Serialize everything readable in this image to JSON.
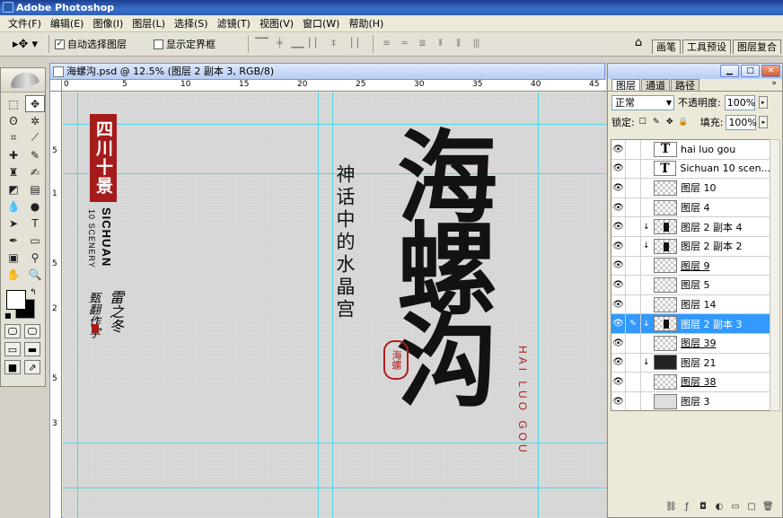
{
  "app": {
    "title": "Adobe Photoshop"
  },
  "menu": [
    "文件(F)",
    "编辑(E)",
    "图像(I)",
    "图层(L)",
    "选择(S)",
    "滤镜(T)",
    "视图(V)",
    "窗口(W)",
    "帮助(H)"
  ],
  "options": {
    "auto_select_label": "自动选择图层",
    "auto_select_checked": "✓",
    "show_bounds_label": "显示定界框",
    "align_icons": [
      "▔▔",
      "╪",
      "▁▁",
      "▏▏",
      "‡",
      "▕▕"
    ],
    "distribute_icons": [
      "≡",
      "═",
      "≣",
      "⦀",
      "⫼",
      "|||"
    ]
  },
  "palette_well": {
    "tabs": [
      "画笔",
      "工具预设",
      "图层复合"
    ]
  },
  "document": {
    "title": "海螺沟.psd @ 12.5% (图层 2 副本 3, RGB/8)",
    "ruler_h": [
      "0",
      "5",
      "10",
      "15",
      "20",
      "25",
      "30",
      "35",
      "40",
      "45"
    ],
    "ruler_v": [
      "5",
      "1",
      "5",
      "2",
      "5",
      "3"
    ]
  },
  "artwork": {
    "red_seal": "四川十景",
    "sichuan": "SICHUAN",
    "scenery": "10 SCENERY",
    "signature_1": "雷之冬",
    "signature_2": "甄翻作字",
    "poem": "神话中的水晶宫",
    "calligraphy": "海螺沟",
    "round_seal": "海螺",
    "hailuo": "HAI LUO GOU"
  },
  "layers_panel": {
    "tabs": [
      "图层",
      "通道",
      "路径"
    ],
    "active_tab": 0,
    "blend_mode": "正常",
    "opacity_label": "不透明度:",
    "opacity_value": "100%",
    "lock_label": "锁定:",
    "lock_icons": [
      "☐",
      "✎",
      "✥",
      "🔒"
    ],
    "fill_label": "填充:",
    "fill_value": "100%",
    "layers": [
      {
        "name": "hai luo gou",
        "thumb": "T",
        "underline": false,
        "clip": "",
        "selected": false,
        "brush": ""
      },
      {
        "name": "Sichuan  10 scen...",
        "thumb": "T",
        "underline": false,
        "clip": "",
        "selected": false,
        "brush": ""
      },
      {
        "name": "图层 10",
        "thumb": "checker",
        "underline": false,
        "clip": "",
        "selected": false,
        "brush": ""
      },
      {
        "name": "图层 4",
        "thumb": "checker",
        "underline": false,
        "clip": "",
        "selected": false,
        "brush": ""
      },
      {
        "name": "图层 2 副本 4",
        "thumb": "blot",
        "underline": false,
        "clip": "↓",
        "selected": false,
        "brush": ""
      },
      {
        "name": "图层 2 副本 2",
        "thumb": "blot",
        "underline": false,
        "clip": "↓",
        "selected": false,
        "brush": ""
      },
      {
        "name": "图层 9",
        "thumb": "checker",
        "underline": true,
        "clip": "",
        "selected": false,
        "brush": ""
      },
      {
        "name": "图层 5",
        "thumb": "checker",
        "underline": false,
        "clip": "",
        "selected": false,
        "brush": ""
      },
      {
        "name": "图层 14",
        "thumb": "checker",
        "underline": false,
        "clip": "",
        "selected": false,
        "brush": ""
      },
      {
        "name": "图层 2 副本 3",
        "thumb": "blot",
        "underline": false,
        "clip": "↓",
        "selected": true,
        "brush": "✎"
      },
      {
        "name": "图层 39",
        "thumb": "checker",
        "underline": true,
        "clip": "",
        "selected": false,
        "brush": ""
      },
      {
        "name": "图层 21",
        "thumb": "dark",
        "underline": false,
        "clip": "↓",
        "selected": false,
        "brush": ""
      },
      {
        "name": "图层 38",
        "thumb": "checker",
        "underline": true,
        "clip": "",
        "selected": false,
        "brush": ""
      },
      {
        "name": "图层 3",
        "thumb": "gray",
        "underline": false,
        "clip": "",
        "selected": false,
        "brush": ""
      }
    ],
    "bottom_icons": [
      "⛓",
      "ƒ",
      "◘",
      "◐",
      "▭",
      "▢",
      "🗑"
    ]
  }
}
